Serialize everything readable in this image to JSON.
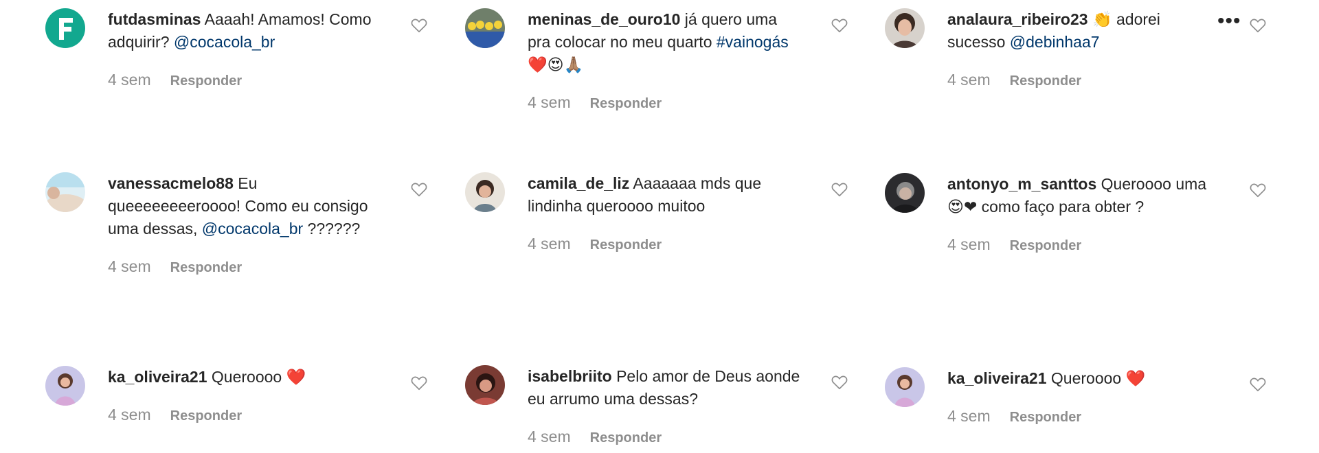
{
  "time_label": "4 sem",
  "reply_label": "Responder",
  "more_label": "•••",
  "colors": {
    "mention": "#00376b",
    "meta": "#8e8e8e",
    "heart_red": "#ed2939",
    "text": "#262626"
  },
  "comments": [
    {
      "username": "futdasminas",
      "parts": [
        {
          "t": "text",
          "v": " Aaaah! Amamos! Como adquirir? "
        },
        {
          "t": "mention",
          "v": "@cocacola_br"
        }
      ]
    },
    {
      "username": "meninas_de_ouro10",
      "parts": [
        {
          "t": "text",
          "v": " já quero uma pra colocar no meu quarto "
        },
        {
          "t": "hashtag",
          "v": "#vainogás"
        },
        {
          "t": "text",
          "v": " ❤️😍🙏🏽"
        }
      ]
    },
    {
      "username": "analaura_ribeiro23",
      "parts": [
        {
          "t": "text",
          "v": " 👏 adorei sucesso "
        },
        {
          "t": "mention",
          "v": "@debinhaa7"
        }
      ]
    },
    {
      "username": "vanessacmelo88",
      "parts": [
        {
          "t": "text",
          "v": " Eu queeeeeeeeroooo! Como eu consigo uma dessas, "
        },
        {
          "t": "mention",
          "v": "@cocacola_br"
        },
        {
          "t": "text",
          "v": " ??????"
        }
      ]
    },
    {
      "username": "camila_de_liz",
      "parts": [
        {
          "t": "text",
          "v": " Aaaaaaa mds que lindinha queroooo muitoo"
        }
      ]
    },
    {
      "username": "antonyo_m_santtos",
      "parts": [
        {
          "t": "text",
          "v": " Queroooo uma 😍❤ como faço para obter ?"
        }
      ]
    },
    {
      "username": "ka_oliveira21",
      "parts": [
        {
          "t": "text",
          "v": " Queroooo ❤️"
        }
      ]
    },
    {
      "username": "isabelbriito",
      "parts": [
        {
          "t": "text",
          "v": " Pelo amor de Deus aonde eu arrumo uma dessas?"
        }
      ]
    },
    {
      "username": "ka_oliveira21",
      "parts": [
        {
          "t": "text",
          "v": " Queroooo ❤️"
        }
      ]
    }
  ]
}
